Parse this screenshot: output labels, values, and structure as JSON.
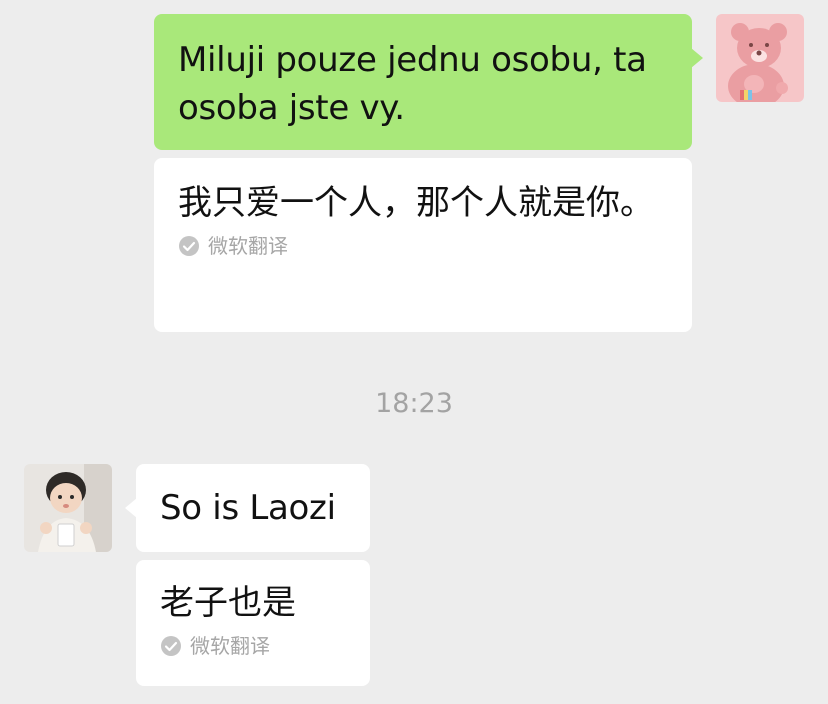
{
  "messages": [
    {
      "sender": "me",
      "text": "Miluji pouze jednu osobu, ta osoba jste vy.",
      "translation": "我只爱一个人，那个人就是你。",
      "translation_source": "微软翻译",
      "bubble_color": "#a9e87a"
    },
    {
      "sender": "other",
      "text": "So is Laozi",
      "translation": "老子也是",
      "translation_source": "微软翻译",
      "bubble_color": "#ffffff"
    }
  ],
  "timestamp": "18:23",
  "avatars": {
    "me": "pink-bear-avatar",
    "other": "baby-photo-avatar"
  },
  "icons": {
    "translation_check": "check-circle-icon"
  },
  "colors": {
    "background": "#ededed",
    "my_bubble": "#a9e87a",
    "other_bubble": "#ffffff",
    "meta_text": "#a3a3a3"
  }
}
